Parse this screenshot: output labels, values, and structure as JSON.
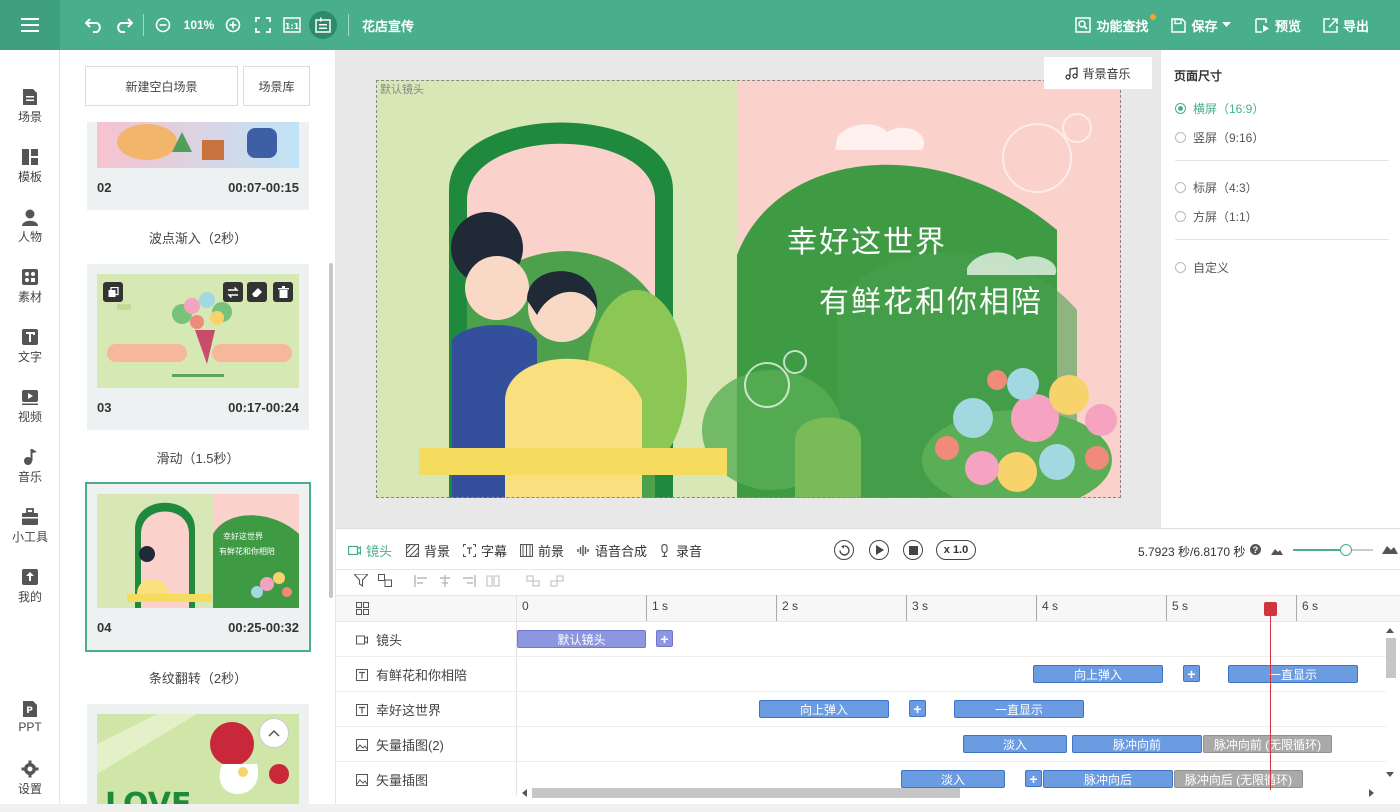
{
  "topbar": {
    "zoom": "101%",
    "project_title": "花店宣传",
    "feature_search": "功能查找",
    "save": "保存",
    "preview": "预览",
    "export": "导出",
    "accent": "#49ae8c"
  },
  "leftnav": [
    {
      "label": "场景",
      "icon": "scene-icon"
    },
    {
      "label": "模板",
      "icon": "template-icon"
    },
    {
      "label": "人物",
      "icon": "person-icon"
    },
    {
      "label": "素材",
      "icon": "material-icon"
    },
    {
      "label": "文字",
      "icon": "text-icon"
    },
    {
      "label": "视频",
      "icon": "video-icon"
    },
    {
      "label": "音乐",
      "icon": "music-icon"
    },
    {
      "label": "小工具",
      "icon": "toolbox-icon"
    },
    {
      "label": "我的",
      "icon": "upload-icon"
    },
    {
      "label": "PPT",
      "icon": "ppt-icon"
    },
    {
      "label": "设置",
      "icon": "gear-icon"
    }
  ],
  "scene_panel": {
    "new_blank": "新建空白场景",
    "library": "场景库",
    "scenes": [
      {
        "num": "02",
        "time": "00:07-00:15",
        "transition": "波点渐入（2秒）"
      },
      {
        "num": "03",
        "time": "00:17-00:24",
        "transition": "滑动（1.5秒）"
      },
      {
        "num": "04",
        "time": "00:25-00:32",
        "transition": "条纹翻转（2秒）"
      }
    ]
  },
  "canvas": {
    "default_shot": "默认镜头",
    "bg_music": "背景音乐",
    "line1": "幸好这世界",
    "line2": "有鲜花和你相陪"
  },
  "right_panel": {
    "title": "页面尺寸",
    "options": [
      {
        "label": "横屏（16:9）",
        "selected": true
      },
      {
        "label": "竖屏（9:16）",
        "selected": false
      },
      {
        "label": "标屏（4:3）",
        "selected": false
      },
      {
        "label": "方屏（1:1）",
        "selected": false
      },
      {
        "label": "自定义",
        "selected": false
      }
    ]
  },
  "timeline": {
    "tabs": [
      "镜头",
      "背景",
      "字幕",
      "前景",
      "语音合成",
      "录音"
    ],
    "speed": "x 1.0",
    "time": "5.7923 秒/6.8170 秒",
    "ruler": [
      "0",
      "1 s",
      "2 s",
      "3 s",
      "4 s",
      "5 s",
      "6 s"
    ],
    "playhead": 5.7923,
    "total": 6.817,
    "tracks": [
      {
        "label": "镜头",
        "clips": [
          "默认镜头"
        ]
      },
      {
        "label": "有鲜花和你相陪",
        "clips": [
          "向上弹入",
          "一直显示"
        ]
      },
      {
        "label": "幸好这世界",
        "clips": [
          "向上弹入",
          "一直显示"
        ]
      },
      {
        "label": "矢量插图(2)",
        "clips": [
          "淡入",
          "脉冲向前",
          "脉冲向前 (无限循环)"
        ]
      },
      {
        "label": "矢量插图",
        "clips": [
          "淡入",
          "脉冲向后",
          "脉冲向后 (无限循环)"
        ]
      }
    ]
  }
}
